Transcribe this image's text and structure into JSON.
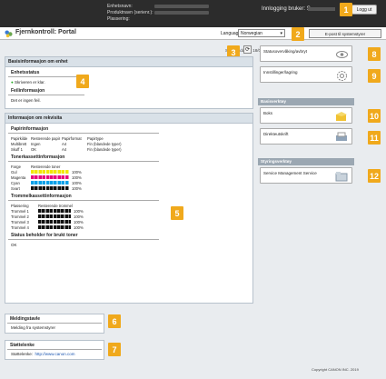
{
  "device": {
    "name_label": "Enhetsnavn:",
    "product_label": "Produktnavn (serienr.):",
    "location_label": "Plassering:",
    "login_label": "Innlogging bruker: S",
    "logout": "Logg ut"
  },
  "header": {
    "title": "Fjernkontroll: Portal",
    "language_label": "Language:",
    "language_value": "Norwegian",
    "email_button": "E-post til systemstyrer"
  },
  "updated": "Sist oppdatert: 18/06 201",
  "basic": {
    "title": "Basisinformasjon om enhet",
    "error_status_title": "Enhetsstatus",
    "error_status_text": "Skriveren er klar.",
    "error_info_title": "Feilinformasjon",
    "error_info_text": "Det er ingen feil."
  },
  "consumables": {
    "title": "Informasjon om rekvisita",
    "paper_title": "Papirinformasjon",
    "paper_headers": [
      "Papirkilde",
      "Resterende papir",
      "Papirformat",
      "Papirtype"
    ],
    "paper_rows": [
      [
        "Multibrett",
        "Ingen",
        "A4",
        "Fin (blandede typer)"
      ],
      [
        "Skuff 1",
        "OK",
        "A4",
        "Fin (blandede typer)"
      ]
    ],
    "toner_title": "Tonerkassettinformasjon",
    "toner_headers": [
      "Farge",
      "Resterende toner"
    ],
    "toner_rows": [
      {
        "name": "Gul",
        "color": "#f2e600",
        "level": "100%"
      },
      {
        "name": "Magenta",
        "color": "#e5007e",
        "level": "100%"
      },
      {
        "name": "Cyan",
        "color": "#00a0e9",
        "level": "100%"
      },
      {
        "name": "Svart",
        "color": "#111111",
        "level": "100%"
      }
    ],
    "drum_title": "Trommelkassettinformasjon",
    "drum_headers": [
      "Plassering",
      "Resterende trommel"
    ],
    "drum_rows": [
      {
        "name": "Trommel 1",
        "level": "100%"
      },
      {
        "name": "Trommel 2",
        "level": "100%"
      },
      {
        "name": "Trommel 3",
        "level": "100%"
      },
      {
        "name": "Trommel 4",
        "level": "100%"
      }
    ],
    "waste_title": "Status beholder for brukt toner",
    "waste_text": "OK"
  },
  "message": {
    "title": "Meldingstavle",
    "text": "Melding fra systemstyrer"
  },
  "support": {
    "title": "Støttelenke",
    "label": "Støttelenke:",
    "link": "http://www.canon.com"
  },
  "side": {
    "status_monitor": "Statusovervåking/avbryt",
    "settings": "Innstillinger/lagring",
    "basic_tools": "Basisverktøy",
    "box": "Boks",
    "direct_print": "Direkteutskrift",
    "mgmt_tools": "Styringsverktøy",
    "service_mgmt": "Service Management Service"
  },
  "badges": [
    "1",
    "2",
    "3",
    "4",
    "5",
    "6",
    "7",
    "8",
    "9",
    "10",
    "11",
    "12"
  ],
  "copyright": "Copyright CANON INC. 2019"
}
